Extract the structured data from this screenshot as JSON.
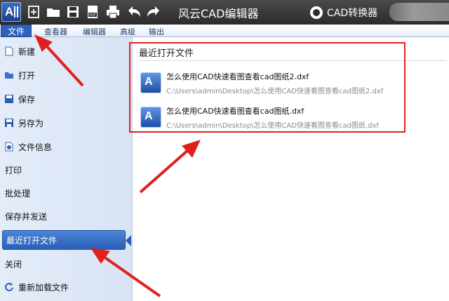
{
  "titlebar": {
    "app_title": "风云CAD编辑器",
    "converter_label": "CAD转换器",
    "toolbar_icons": [
      "new-icon",
      "open-folder-icon",
      "save-icon",
      "pdf-icon",
      "print-icon",
      "undo-icon",
      "redo-icon"
    ]
  },
  "menubar": {
    "file": "文件",
    "viewer": "查看器",
    "editor": "编辑器",
    "advanced": "高级",
    "output": "输出"
  },
  "sidebar": {
    "items": [
      {
        "label": "新建",
        "icon": "new-doc-icon"
      },
      {
        "label": "打开",
        "icon": "open-folder-icon"
      },
      {
        "label": "保存",
        "icon": "save-icon"
      },
      {
        "label": "另存为",
        "icon": "save-as-icon"
      },
      {
        "label": "文件信息",
        "icon": "file-info-icon"
      },
      {
        "label": "打印"
      },
      {
        "label": "批处理"
      },
      {
        "label": "保存并发送"
      },
      {
        "label": "最近打开文件",
        "active": true
      },
      {
        "label": "关闭"
      },
      {
        "label": "重新加载文件",
        "icon": "reload-icon"
      }
    ]
  },
  "recent": {
    "title": "最近打开文件",
    "files": [
      {
        "name": "怎么使用CAD快速看图查看cad图纸2.dxf",
        "path": "C:\\Users\\admin\\Desktop\\怎么使用CAD快速看图查看cad图纸2.dxf"
      },
      {
        "name": "怎么使用CAD快速看图查看cad图纸.dxf",
        "path": "C:\\Users\\admin\\Desktop\\怎么使用CAD快速看图查看cad图纸.dxf"
      }
    ]
  },
  "colors": {
    "titlebar_bg": "#2b2b2b",
    "accent_blue": "#2d62b8",
    "annotation_red": "#e21f1f",
    "sidebar_bg": "#dde7f6"
  }
}
